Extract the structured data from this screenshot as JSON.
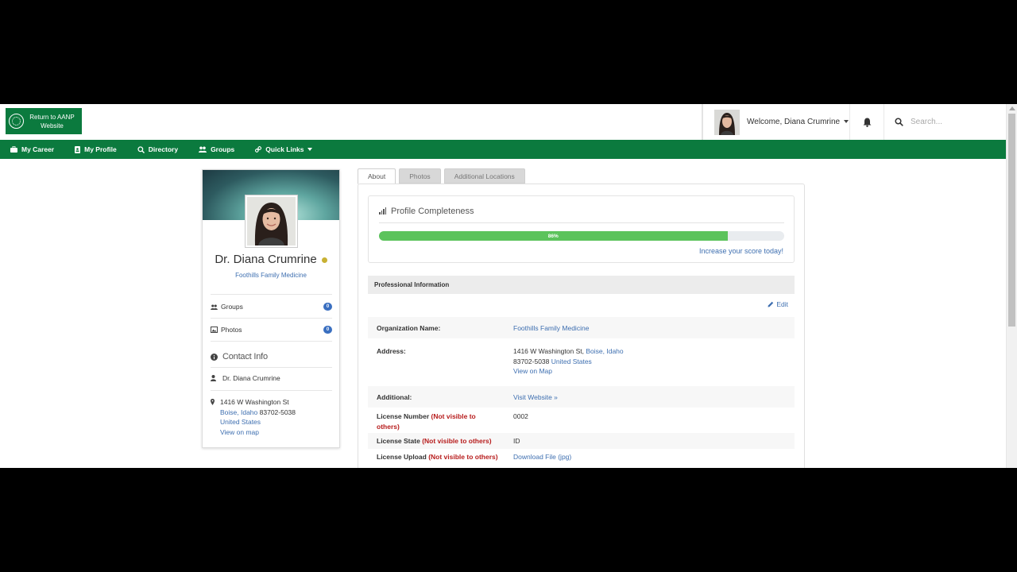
{
  "header": {
    "return_button": "Return to AANP Website",
    "welcome": "Welcome, Diana Crumrine",
    "search_placeholder": "Search..."
  },
  "nav": {
    "items": [
      "My Career",
      "My Profile",
      "Directory",
      "Groups",
      "Quick Links"
    ]
  },
  "profile": {
    "name": "Dr. Diana Crumrine",
    "organization": "Foothills Family Medicine",
    "groups_label": "Groups",
    "groups_count": "0",
    "photos_label": "Photos",
    "photos_count": "0",
    "contact_title": "Contact Info",
    "contact_name": "Dr. Diana Crumrine",
    "street": "1416 W Washington St",
    "city_state": "Boise, Idaho",
    "zip": "83702-5038",
    "country": "United States",
    "map_link": "View on map"
  },
  "tabs": [
    "About",
    "Photos",
    "Additional Locations"
  ],
  "completeness": {
    "title": "Profile Completeness",
    "percent_label": "86%",
    "percent": 86,
    "increase_link": "Increase your score today!"
  },
  "professional": {
    "header": "Professional Information",
    "edit": "Edit",
    "org_label": "Organization Name:",
    "org_value": "Foothills Family Medicine",
    "address_label": "Address:",
    "address_street": "1416 W Washington St,",
    "address_city": "Boise,",
    "address_state": "Idaho",
    "address_zip": "83702-5038",
    "address_country": "United States",
    "address_map": "View on Map",
    "additional_label": "Additional:",
    "additional_value": "Visit Website »",
    "license_number_label": "License Number",
    "license_number_note": "(Not visible to others)",
    "license_number_value": "0002",
    "license_state_label": "License State",
    "license_state_note": "(Not visible to others)",
    "license_state_value": "ID",
    "license_upload_label": "License Upload",
    "license_upload_note": "(Not visible to others)",
    "license_upload_value": "Download File (jpg)"
  },
  "colors": {
    "brand_green": "#0b7a3e",
    "link_blue": "#3e6fb0",
    "progress_green": "#5cc35c",
    "warning_red": "#b71c1c"
  }
}
